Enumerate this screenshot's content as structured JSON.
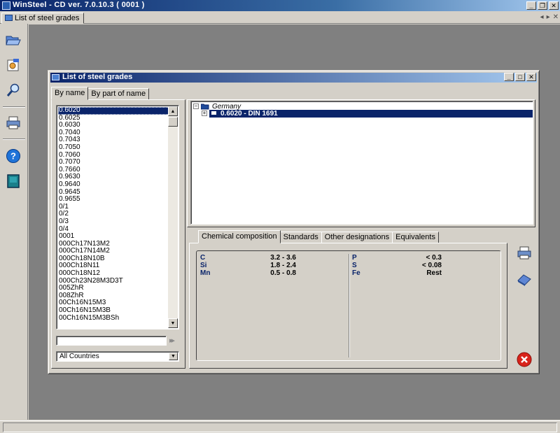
{
  "app": {
    "title": "WinSteel - CD ver. 7.0.10.3 ( 0001 )",
    "doc_tab": "List of steel grades"
  },
  "window": {
    "title": "List of steel grades"
  },
  "search_tabs": [
    "By name",
    "By part of name"
  ],
  "grades": [
    "0.6020",
    "0.6025",
    "0.6030",
    "0.7040",
    "0.7043",
    "0.7050",
    "0.7060",
    "0.7070",
    "0.7660",
    "0.9630",
    "0.9640",
    "0.9645",
    "0.9655",
    "0/1",
    "0/2",
    "0/3",
    "0/4",
    "0001",
    "000Ch17N13M2",
    "000Ch17N14M2",
    "000Ch18N10B",
    "000Ch18N11",
    "000Ch18N12",
    "000Ch23N28M3D3T",
    "005ZhR",
    "008ZhR",
    "00Ch16N15M3",
    "00Ch16N15M3B",
    "00Ch16N15M3BSh"
  ],
  "selected_grade": "0.6020",
  "search": {
    "value": ""
  },
  "country_filter": "All Countries",
  "tree": {
    "country": "Germany",
    "entry": "0.6020  -  DIN 1691"
  },
  "detail_tabs": [
    "Chemical composition",
    "Standards",
    "Other designations",
    "Equivalents"
  ],
  "composition": {
    "left": [
      {
        "element": "C",
        "value": "3.2 - 3.6"
      },
      {
        "element": "Si",
        "value": "1.8 - 2.4"
      },
      {
        "element": "Mn",
        "value": "0.5 - 0.8"
      }
    ],
    "right": [
      {
        "element": "P",
        "value": "< 0.3"
      },
      {
        "element": "S",
        "value": "< 0.08"
      },
      {
        "element": "Fe",
        "value": "Rest"
      }
    ]
  },
  "icons": {
    "sidebar": [
      "open-folder-icon",
      "settings-icon",
      "search-icon",
      "print-icon",
      "help-icon",
      "book-icon"
    ],
    "right": [
      "print-icon",
      "eraser-icon",
      "close-icon"
    ]
  }
}
